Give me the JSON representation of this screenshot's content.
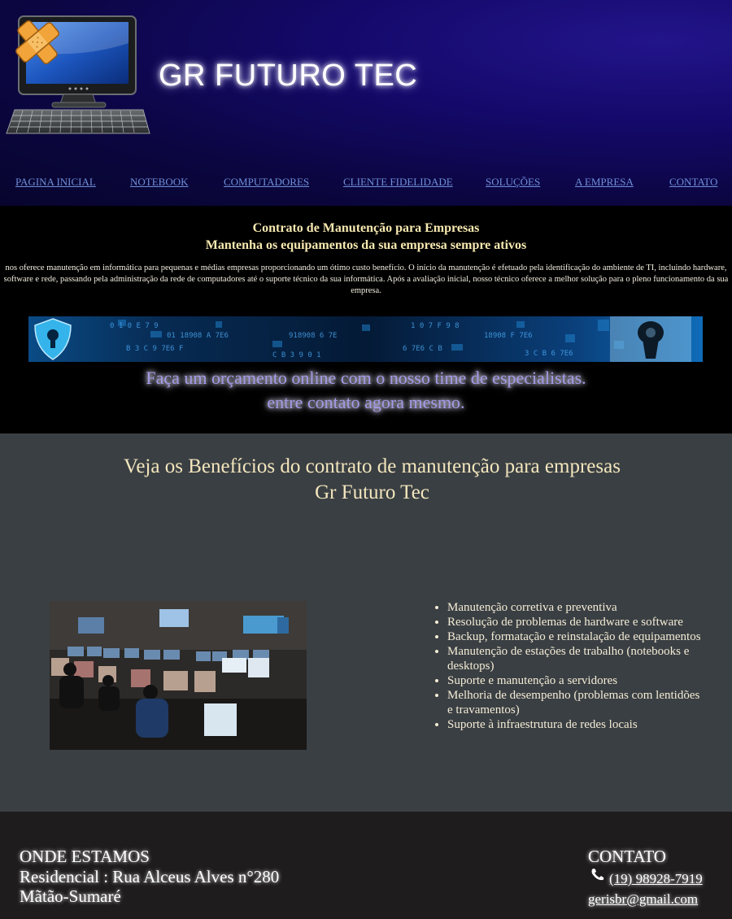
{
  "header": {
    "site_title": "GR FUTURO TEC",
    "logo_icon": "computer-plus-logo-icon",
    "nav": [
      {
        "label": "PAGINA INICIAL"
      },
      {
        "label": "NOTEBOOK"
      },
      {
        "label": "COMPUTADORES"
      },
      {
        "label": "CLIENTE FIDELIDADE"
      },
      {
        "label": "SOLUÇÕES"
      },
      {
        "label": "A EMPRESA"
      },
      {
        "label": "CONTATO"
      }
    ]
  },
  "contract": {
    "title_line1": "Contrato de Manutenção para Empresas",
    "title_line2": "Mantenha os equipamentos da sua empresa sempre ativos",
    "description": "nos oferece manutenção em informática para pequenas e médias empresas proporcionando um ótimo custo benefício. O início da manutenção é efetuado pela identificação do ambiente de TI, incluindo hardware, software e rede, passando pela administração da rede de computadores até o suporte técnico da sua informática. Após a avaliação inicial, nosso técnico oferece a melhor solução para o pleno funcionamento da sua empresa.",
    "banner_icon": "security-lock-banner",
    "cta_line1": "Faça um orçamento online com o nosso time de especialistas.",
    "cta_line2": "entre contato agora mesmo."
  },
  "benefits": {
    "title_line1": "Veja os Benefícios do contrato de manutenção para empresas",
    "title_line2": "Gr Futuro Tec",
    "photo_icon": "control-room-photo",
    "items": [
      "Manutenção corretiva e preventiva",
      "Resolução de problemas de hardware e software",
      "Backup, formatação e reinstalação de equipamentos",
      "Manutenção de estações de trabalho (notebooks e desktops)",
      "Suporte e manutenção a servidores",
      "Melhoria de desempenho (problemas com lentidões e travamentos)",
      "Suporte à infraestrutura de redes locais"
    ]
  },
  "footer": {
    "location_heading": "ONDE ESTAMOS",
    "address_line1": "Residencial : Rua Alceus Alves n°280",
    "address_line2": "Mãtão-Sumaré",
    "contact_heading": "CONTATO",
    "phone": "(19) 98928-7919",
    "phone_icon": "phone-icon",
    "email": "gerisbr@gmail.com"
  }
}
